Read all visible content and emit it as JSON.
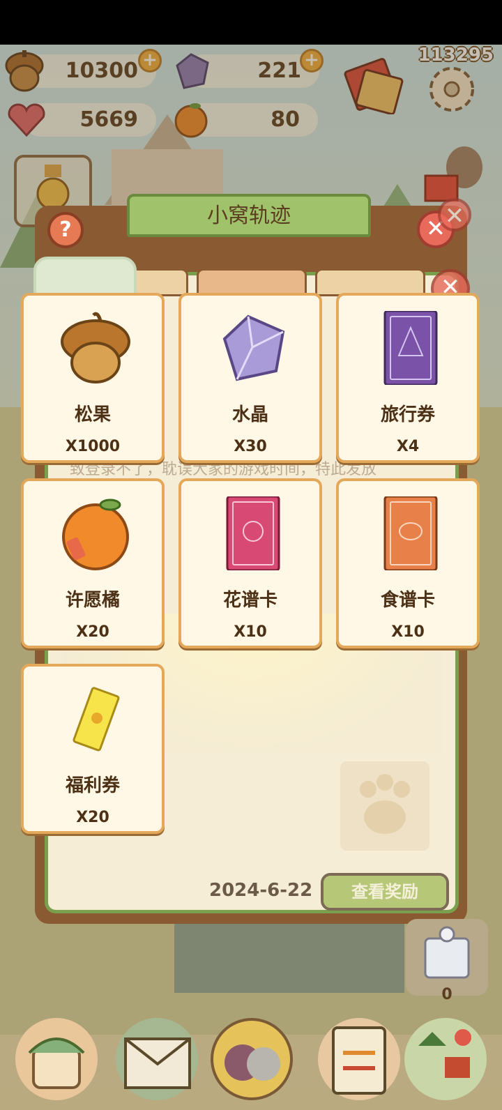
{
  "counter": "113295",
  "resources": {
    "acorn": "10300",
    "crystal": "221",
    "heart": "5669",
    "orange": "80"
  },
  "panel": {
    "title": "小窝轨迹",
    "help": "?",
    "close": "✕",
    "date": "2024-6-22",
    "view_reward": "查看奖励",
    "notice_line": "致登录不了，耽误大家的游戏时间，特此发放"
  },
  "side_gift_count": "0",
  "rewards": [
    {
      "name": "松果",
      "qty": "X1000",
      "icon": "acorn-icon"
    },
    {
      "name": "水晶",
      "qty": "X30",
      "icon": "crystal-icon"
    },
    {
      "name": "旅行券",
      "qty": "X4",
      "icon": "travel-card-icon"
    },
    {
      "name": "许愿橘",
      "qty": "X20",
      "icon": "wish-orange-icon"
    },
    {
      "name": "花谱卡",
      "qty": "X10",
      "icon": "flower-card-icon"
    },
    {
      "name": "食谱卡",
      "qty": "X10",
      "icon": "recipe-card-icon"
    },
    {
      "name": "福利券",
      "qty": "X20",
      "icon": "welfare-ticket-icon"
    }
  ],
  "colors": {
    "card_border": "#e4a85a",
    "card_bg": "#fff8e6",
    "text": "#4d3116",
    "accent_green": "#9fc26a"
  }
}
